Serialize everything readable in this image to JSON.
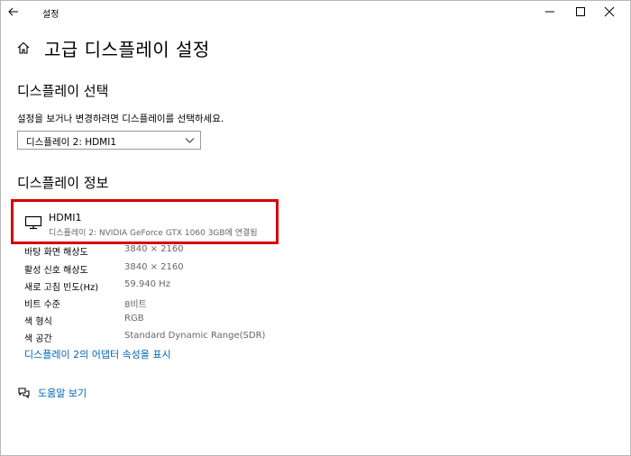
{
  "titlebar": {
    "title": "설정"
  },
  "page": {
    "title": "고급 디스플레이 설정"
  },
  "select_section": {
    "heading": "디스플레이 선택",
    "description": "설정을 보거나 변경하려면 디스플레이를 선택하세요.",
    "dropdown_value": "디스플레이 2: HDMI1"
  },
  "info_section": {
    "heading": "디스플레이 정보",
    "display_name": "HDMI1",
    "display_subtitle": "디스플레이 2: NVIDIA GeForce GTX 1060 3GB에 연결됨",
    "rows": [
      {
        "label": "바탕 화면 해상도",
        "value": "3840 × 2160"
      },
      {
        "label": "활성 신호 해상도",
        "value": "3840 × 2160"
      },
      {
        "label": "새로 고침 빈도(Hz)",
        "value": "59.940 Hz"
      },
      {
        "label": "비트 수준",
        "value": "8비트"
      },
      {
        "label": "색 형식",
        "value": "RGB"
      },
      {
        "label": "색 공간",
        "value": "Standard Dynamic Range(SDR)"
      }
    ],
    "adapter_link": "디스플레이 2의 어댑터 속성을 표시"
  },
  "help": {
    "label": "도움말 보기"
  },
  "colors": {
    "link": "#0063b1",
    "highlight_border": "#d60000"
  },
  "icons": [
    "back-arrow-icon",
    "minimize-icon",
    "maximize-icon",
    "close-icon",
    "home-icon",
    "chevron-down-icon",
    "monitor-icon",
    "help-chat-icon"
  ]
}
